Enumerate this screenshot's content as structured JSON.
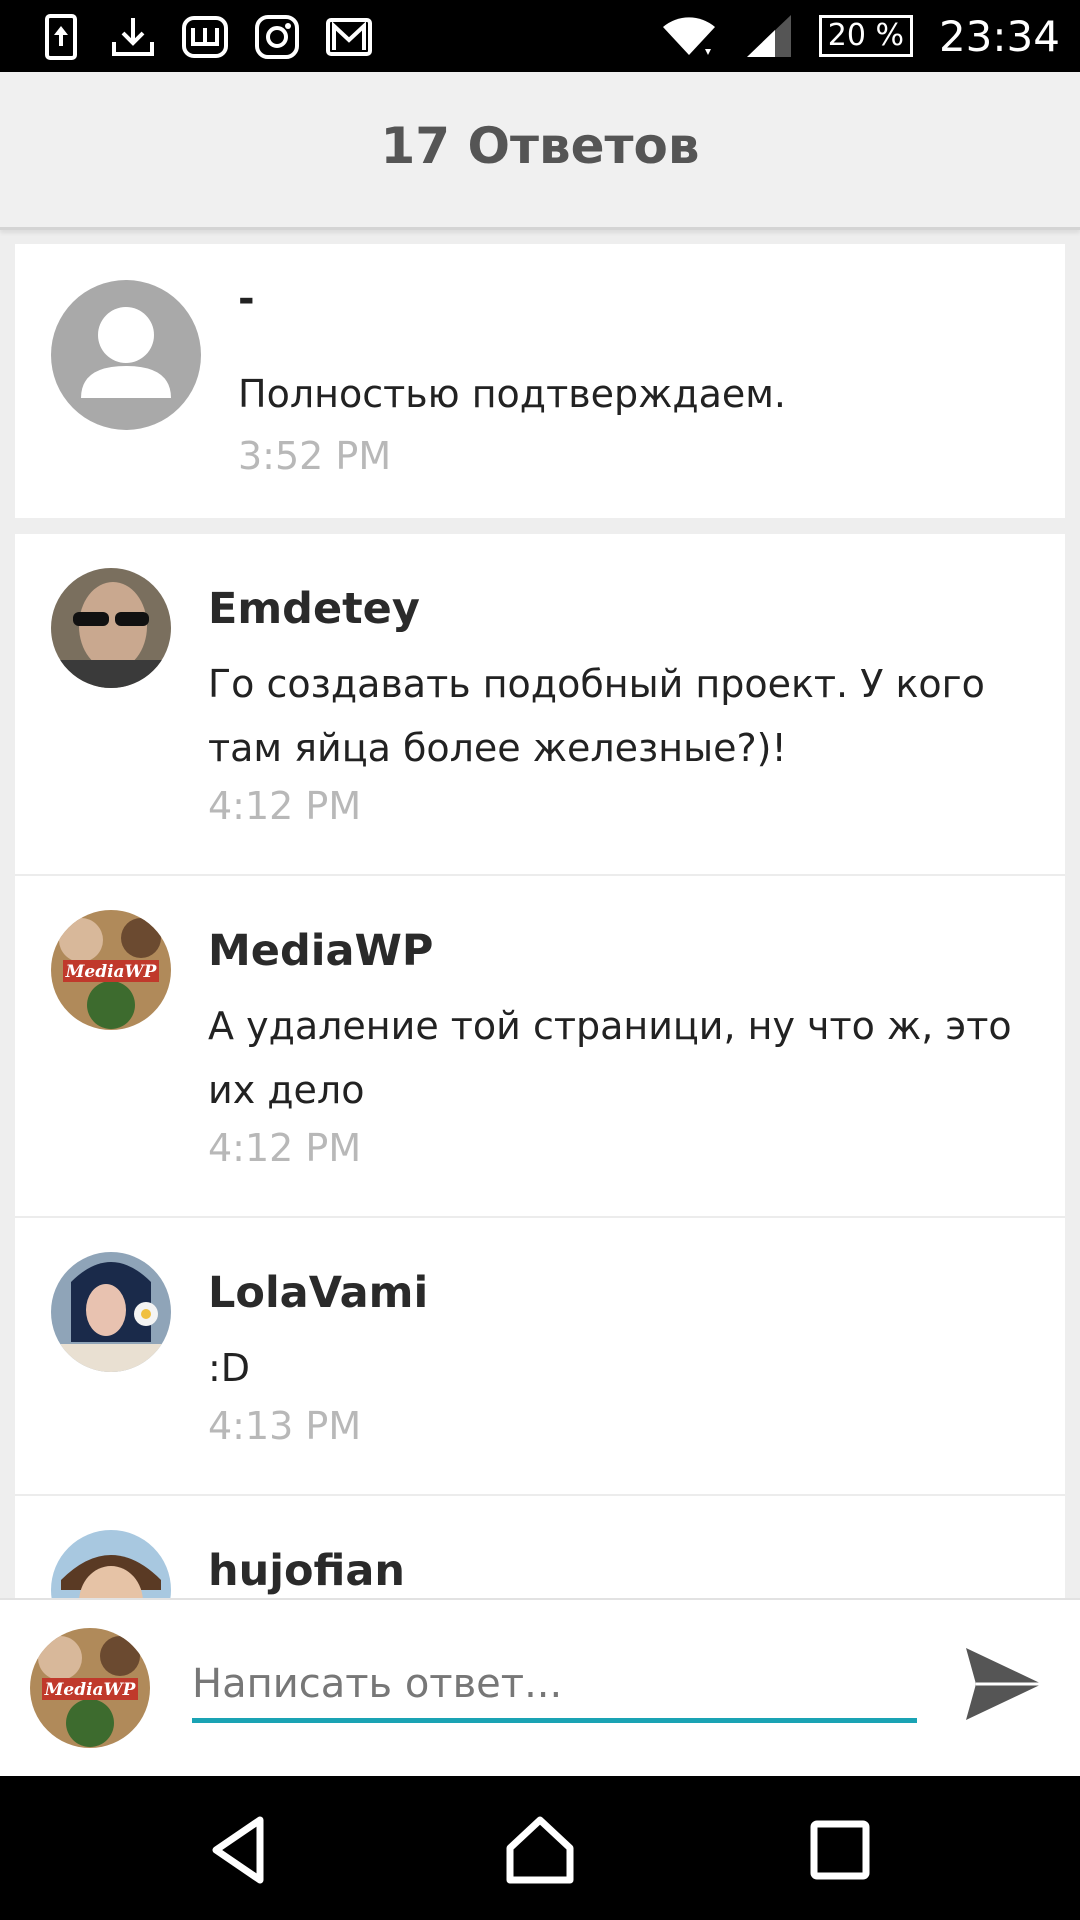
{
  "status_bar": {
    "battery": "20 %",
    "time": "23:34"
  },
  "header": {
    "title": "17 Ответов"
  },
  "post": {
    "author": "-",
    "message": "Полностью подтверждаем.",
    "time": "3:52 PM"
  },
  "replies": [
    {
      "author": "Emdetey",
      "message": "Го создавать подобный проект. У кого там яйца более железные?)!",
      "time": "4:12 PM"
    },
    {
      "author": "MediaWP",
      "message": "А удаление той страници, ну что ж, это их дело",
      "time": "4:12 PM",
      "avatar_text": "MediaWP"
    },
    {
      "author": "LolaVami",
      "message": ":D",
      "time": "4:13 PM"
    },
    {
      "author": "hujofian",
      "message": "",
      "time": ""
    }
  ],
  "compose": {
    "placeholder": "Написать ответ...",
    "avatar_text": "MediaWP"
  },
  "colors": {
    "accent": "#1aa3b4",
    "timestamp": "#b8b8b8"
  }
}
